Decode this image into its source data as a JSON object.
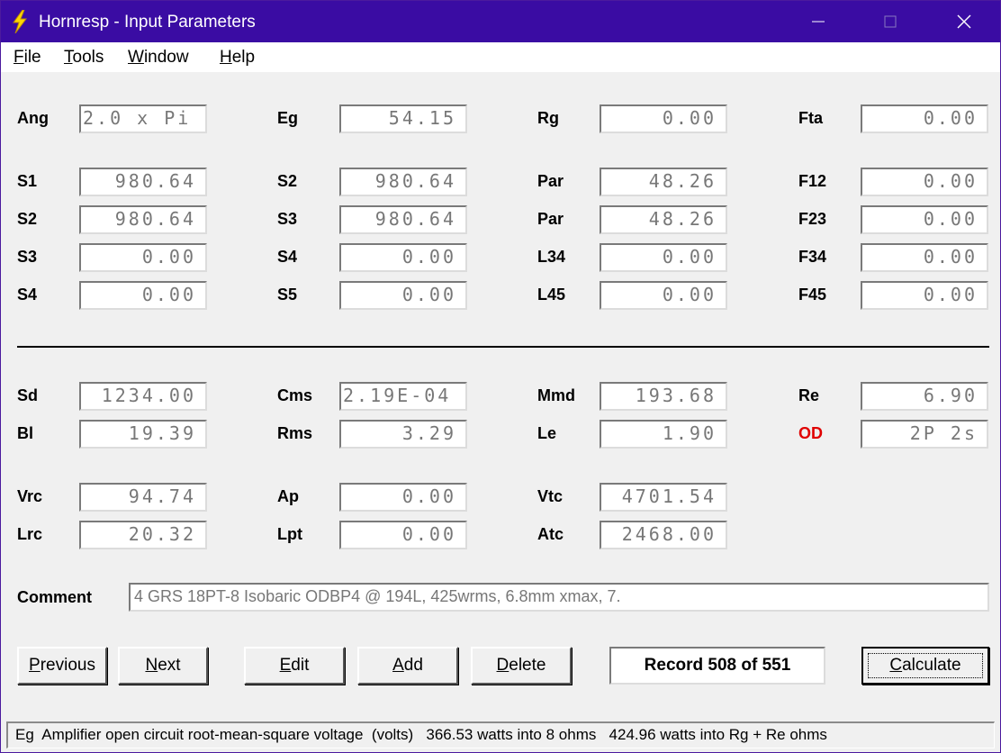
{
  "window": {
    "title": "Hornresp - Input Parameters",
    "controls": {
      "minimize": "minimize",
      "maximize": "maximize",
      "close": "close"
    }
  },
  "menu": [
    {
      "mnemonic": "F",
      "rest": "ile"
    },
    {
      "mnemonic": "T",
      "rest": "ools"
    },
    {
      "mnemonic": "W",
      "rest": "indow"
    },
    {
      "mnemonic": "H",
      "rest": "elp"
    }
  ],
  "params": {
    "ang": {
      "label": "Ang",
      "value": "2.0 x Pi"
    },
    "eg": {
      "label": "Eg",
      "value": "54.15"
    },
    "rg": {
      "label": "Rg",
      "value": "0.00"
    },
    "fta": {
      "label": "Fta",
      "value": "0.00"
    },
    "r1": {
      "s_label": "S1",
      "s_value": "980.64",
      "s2_label": "S2",
      "s2_value": "980.64",
      "p_label": "Par",
      "p_value": "48.26",
      "f_label": "F12",
      "f_value": "0.00"
    },
    "r2": {
      "s_label": "S2",
      "s_value": "980.64",
      "s2_label": "S3",
      "s2_value": "980.64",
      "p_label": "Par",
      "p_value": "48.26",
      "f_label": "F23",
      "f_value": "0.00"
    },
    "r3": {
      "s_label": "S3",
      "s_value": "0.00",
      "s2_label": "S4",
      "s2_value": "0.00",
      "p_label": "L34",
      "p_value": "0.00",
      "f_label": "F34",
      "f_value": "0.00"
    },
    "r4": {
      "s_label": "S4",
      "s_value": "0.00",
      "s2_label": "S5",
      "s2_value": "0.00",
      "p_label": "L45",
      "p_value": "0.00",
      "f_label": "F45",
      "f_value": "0.00"
    },
    "sd": {
      "label": "Sd",
      "value": "1234.00"
    },
    "cms": {
      "label": "Cms",
      "value": "2.19E-04"
    },
    "mmd": {
      "label": "Mmd",
      "value": "193.68"
    },
    "re": {
      "label": "Re",
      "value": "6.90"
    },
    "bl": {
      "label": "Bl",
      "value": "19.39"
    },
    "rms": {
      "label": "Rms",
      "value": "3.29"
    },
    "le": {
      "label": "Le",
      "value": "1.90"
    },
    "od": {
      "label": "OD",
      "value": "2P 2s",
      "color": "#e00000"
    },
    "vrc": {
      "label": "Vrc",
      "value": "94.74"
    },
    "ap": {
      "label": "Ap",
      "value": "0.00"
    },
    "vtc": {
      "label": "Vtc",
      "value": "4701.54"
    },
    "lrc": {
      "label": "Lrc",
      "value": "20.32"
    },
    "lpt": {
      "label": "Lpt",
      "value": "0.00"
    },
    "atc": {
      "label": "Atc",
      "value": "2468.00"
    }
  },
  "comment": {
    "label": "Comment",
    "value": "4 GRS 18PT-8 Isobaric ODBP4 @ 194L, 425wrms, 6.8mm xmax, 7."
  },
  "buttons": {
    "previous": {
      "mnemonic": "P",
      "rest": "revious"
    },
    "next": {
      "mnemonic": "N",
      "rest": "ext"
    },
    "edit": {
      "mnemonic": "E",
      "rest": "dit"
    },
    "add": {
      "mnemonic": "A",
      "rest": "dd"
    },
    "delete": {
      "mnemonic": "D",
      "rest": "elete"
    },
    "calculate": {
      "mnemonic": "C",
      "rest": "alculate"
    }
  },
  "record": "Record 508 of 551",
  "status": "Eg  Amplifier open circuit root-mean-square voltage  (volts)   366.53 watts into 8 ohms   424.96 watts into Rg + Re ohms",
  "colors": {
    "titlebar": "#3a0ca3",
    "warning_label": "#e00000",
    "icon": "#ffd700"
  }
}
